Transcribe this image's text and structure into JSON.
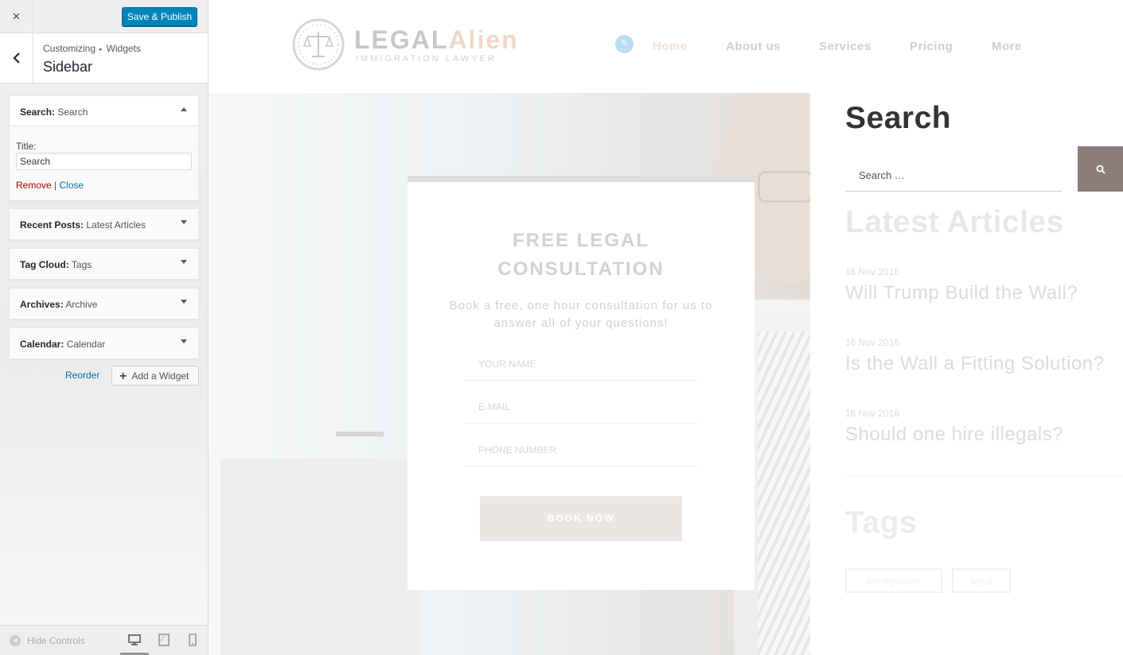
{
  "customizer": {
    "close_label": "×",
    "save_label": "Save & Publish",
    "breadcrumb": {
      "root": "Customizing",
      "separator": "▸",
      "section": "Widgets"
    },
    "section_title": "Sidebar",
    "widgets": [
      {
        "type": "Search:",
        "title": "Search",
        "expanded": true
      },
      {
        "type": "Recent Posts:",
        "title": "Latest Articles",
        "expanded": false
      },
      {
        "type": "Tag Cloud:",
        "title": "Tags",
        "expanded": false
      },
      {
        "type": "Archives:",
        "title": "Archive",
        "expanded": false
      },
      {
        "type": "Calendar:",
        "title": "Calendar",
        "expanded": false
      }
    ],
    "search_form": {
      "title_label": "Title:",
      "title_value": "Search",
      "remove_label": "Remove",
      "divider": "|",
      "close_label": "Close"
    },
    "reorder_label": "Reorder",
    "add_widget_label": "Add a Widget",
    "add_widget_glyph": "+",
    "hide_controls_label": "Hide Controls",
    "colors": {
      "primary_button": "#0085ba",
      "link": "#0073aa",
      "danger_link": "#a00"
    }
  },
  "site": {
    "logo": {
      "name_part1": "LEGAL",
      "name_part2": "Alien",
      "tagline": "IMMIGRATION LAWYER"
    },
    "nav": [
      "Home",
      "About us",
      "Services",
      "Pricing",
      "More"
    ],
    "hero_form": {
      "title_line1": "FREE LEGAL",
      "title_line2": "CONSULTATION",
      "subtitle": "Book a free, one hour consultation for us to answer all of your questions!",
      "name_placeholder": "YOUR NAME",
      "email_placeholder": "E-MAIL",
      "phone_placeholder": "PHONE NUMBER",
      "button_label": "BOOK NOW"
    },
    "sidebar": {
      "search_title": "Search",
      "search_placeholder": "Search …",
      "latest_title": "Latest Articles",
      "posts": [
        {
          "date": "16 Nov 2016",
          "title": "Will Trump Build the Wall?"
        },
        {
          "date": "16 Nov 2016",
          "title": "Is the Wall a Fitting Solution?"
        },
        {
          "date": "16 Nov 2016",
          "title": "Should one hire illegals?"
        }
      ],
      "tags_title": "Tags",
      "tags": [
        "immigration",
        "legal"
      ]
    },
    "colors": {
      "search_button": "#8b7e78",
      "logo_accent": "#eed9c8"
    }
  },
  "icons": {
    "close": "close-icon",
    "back": "chevron-left-icon",
    "search": "search-icon",
    "edit": "pencil-icon",
    "desktop": "desktop-icon",
    "tablet": "tablet-icon",
    "mobile": "mobile-icon",
    "hide": "arrow-left-circle-icon"
  }
}
